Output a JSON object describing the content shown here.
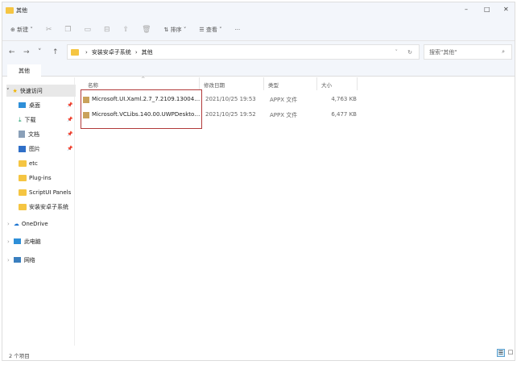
{
  "window": {
    "title": "其他",
    "minimize": "–",
    "maximize": "□",
    "close": "✕"
  },
  "toolbar": {
    "new_label": "新建",
    "sort_label": "排序",
    "view_label": "查看",
    "more_label": "···"
  },
  "address": {
    "segments": [
      "安装安卓子系统",
      "其他"
    ],
    "search_placeholder": "搜索\"其他\""
  },
  "tab": {
    "label": "其他"
  },
  "sidebar": {
    "quick_access": "快速访问",
    "items": [
      {
        "label": "桌面",
        "pinned": true,
        "icon": "desktop-icon"
      },
      {
        "label": "下载",
        "pinned": true,
        "icon": "download-icon"
      },
      {
        "label": "文档",
        "pinned": true,
        "icon": "document-icon"
      },
      {
        "label": "图片",
        "pinned": true,
        "icon": "picture-icon"
      },
      {
        "label": "etc",
        "pinned": false,
        "icon": "folder-icon"
      },
      {
        "label": "Plug-ins",
        "pinned": false,
        "icon": "folder-icon"
      },
      {
        "label": "ScriptUI Panels",
        "pinned": false,
        "icon": "folder-icon"
      },
      {
        "label": "安装安卓子系统",
        "pinned": false,
        "icon": "folder-icon"
      }
    ],
    "onedrive": "OneDrive",
    "this_pc": "此电脑",
    "network": "网络"
  },
  "columns": {
    "name": "名称",
    "date": "修改日期",
    "type": "类型",
    "size": "大小"
  },
  "files": [
    {
      "name": "Microsoft.UI.Xaml.2.7_7.2109.13004.0_...",
      "date": "2021/10/25 19:53",
      "type": "APPX 文件",
      "size": "4,763 KB"
    },
    {
      "name": "Microsoft.VCLibs.140.00.UWPDesktop_...",
      "date": "2021/10/25 19:52",
      "type": "APPX 文件",
      "size": "6,477 KB"
    }
  ],
  "status": {
    "count": "2 个项目"
  }
}
